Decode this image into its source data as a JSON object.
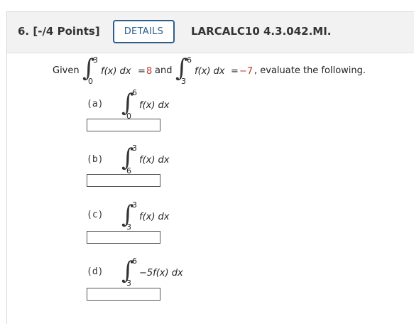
{
  "question": {
    "number_label": "6.",
    "points_label": "[-/4 Points]",
    "details_label": "DETAILS",
    "problem_id": "LARCALC10 4.3.042.MI."
  },
  "given": {
    "given_word": "Given",
    "int1_upper": "3",
    "int1_lower": "0",
    "int1_integrand": "f(x) dx",
    "equals1": "=",
    "value1": "8",
    "and_word": "and",
    "int2_upper": "6",
    "int2_lower": "3",
    "int2_integrand": "f(x) dx",
    "equals2": "=",
    "value2": "−7",
    "tail": ", evaluate the following."
  },
  "parts": [
    {
      "label": "(a)",
      "upper": "6",
      "lower": "0",
      "integrand": "f(x) dx",
      "answer": ""
    },
    {
      "label": "(b)",
      "upper": "3",
      "lower": "6",
      "integrand": "f(x) dx",
      "answer": ""
    },
    {
      "label": "(c)",
      "upper": "3",
      "lower": "3",
      "integrand": "f(x) dx",
      "answer": ""
    },
    {
      "label": "(d)",
      "upper": "6",
      "lower": "3",
      "integrand": "−5f(x) dx",
      "answer": ""
    }
  ],
  "colors": {
    "accent": "#2d5f8a",
    "value_red": "#c0392b"
  }
}
